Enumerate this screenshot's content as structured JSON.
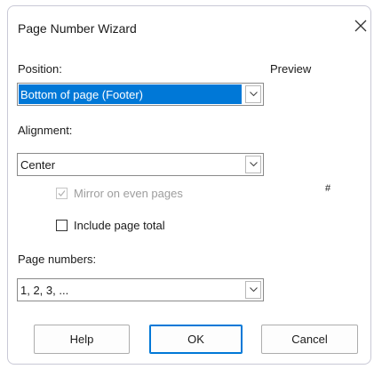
{
  "dialog": {
    "title": "Page Number Wizard",
    "close_icon": "close-icon"
  },
  "position": {
    "label": "Position:",
    "value": "Bottom of page (Footer)"
  },
  "preview": {
    "label": "Preview",
    "marker": "#"
  },
  "alignment": {
    "label": "Alignment:",
    "value": "Center"
  },
  "mirror": {
    "label": "Mirror on even pages",
    "checked": true,
    "enabled": false
  },
  "include_total": {
    "label": "Include page total",
    "checked": false
  },
  "page_numbers": {
    "label": "Page numbers:",
    "value": "1, 2, 3, ..."
  },
  "buttons": {
    "help": "Help",
    "ok": "OK",
    "cancel": "Cancel"
  },
  "colors": {
    "accent": "#0078d7",
    "disabled": "#9d9d9d"
  }
}
